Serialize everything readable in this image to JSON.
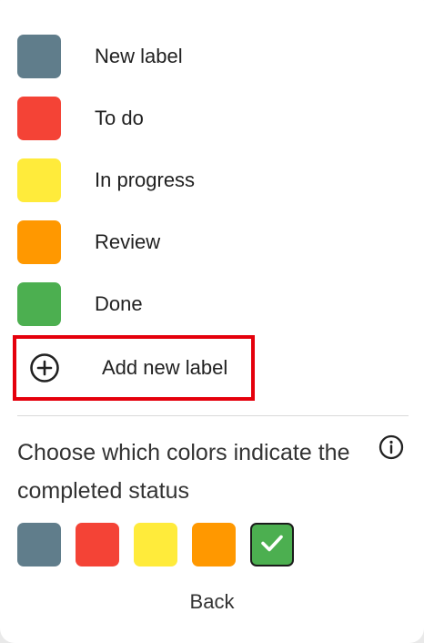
{
  "labels": [
    {
      "text": "New label",
      "color": "#607d8b"
    },
    {
      "text": "To do",
      "color": "#f44336"
    },
    {
      "text": "In progress",
      "color": "#ffeb3b"
    },
    {
      "text": "Review",
      "color": "#ff9800"
    },
    {
      "text": "Done",
      "color": "#4caf50"
    }
  ],
  "add_label": {
    "text": "Add new label",
    "icon": "plus-circle-icon"
  },
  "completed": {
    "title": "Choose which colors indicate the completed status",
    "info_icon": "info-icon",
    "swatches": [
      {
        "color": "#607d8b",
        "selected": false
      },
      {
        "color": "#f44336",
        "selected": false
      },
      {
        "color": "#ffeb3b",
        "selected": false
      },
      {
        "color": "#ff9800",
        "selected": false
      },
      {
        "color": "#4caf50",
        "selected": true
      }
    ]
  },
  "back_label": "Back"
}
